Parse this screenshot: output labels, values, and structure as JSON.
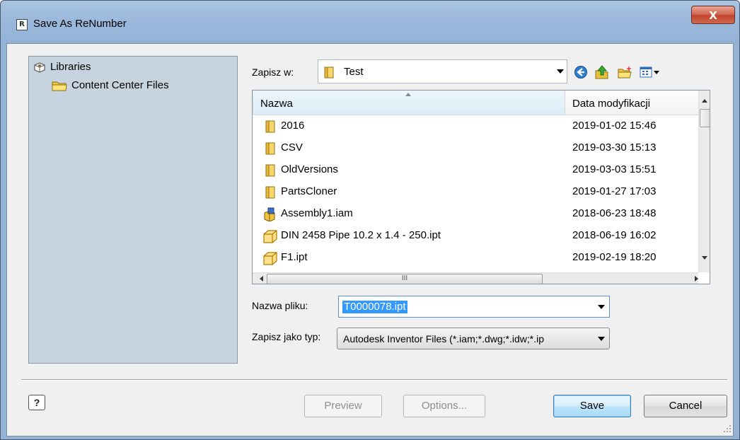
{
  "window": {
    "app_icon_letter": "R",
    "title": "Save As ReNumber",
    "close_label": "X"
  },
  "libraries": {
    "root": "Libraries",
    "children": [
      "Content Center Files"
    ]
  },
  "save_in": {
    "label": "Zapisz w:",
    "value": "Test"
  },
  "toolbar": {
    "icons": [
      "back-icon",
      "up-folder-icon",
      "new-folder-icon",
      "view-menu-icon"
    ]
  },
  "file_list": {
    "columns": [
      "Nazwa",
      "Data modyfikacji"
    ],
    "rows": [
      {
        "name": "2016",
        "date": "2019-01-02 15:46",
        "icon": "folder"
      },
      {
        "name": "CSV",
        "date": "2019-03-30 15:13",
        "icon": "folder"
      },
      {
        "name": "OldVersions",
        "date": "2019-03-03 15:51",
        "icon": "folder"
      },
      {
        "name": "PartsCloner",
        "date": "2019-01-27 17:03",
        "icon": "folder"
      },
      {
        "name": "Assembly1.iam",
        "date": "2018-06-23 18:48",
        "icon": "assembly"
      },
      {
        "name": "DIN 2458 Pipe 10.2 x 1.4 - 250.ipt",
        "date": "2018-06-19 16:02",
        "icon": "part"
      },
      {
        "name": "F1.ipt",
        "date": "2019-02-19 18:20",
        "icon": "part"
      }
    ],
    "hscroll_thumb_label": "III"
  },
  "file_name": {
    "label": "Nazwa pliku:",
    "value": "T0000078.ipt"
  },
  "file_type": {
    "label": "Zapisz jako typ:",
    "value": "Autodesk Inventor Files (*.iam;*.dwg;*.idw;*.ip"
  },
  "buttons": {
    "help": "?",
    "preview": "Preview",
    "options": "Options...",
    "save": "Save",
    "cancel": "Cancel"
  }
}
